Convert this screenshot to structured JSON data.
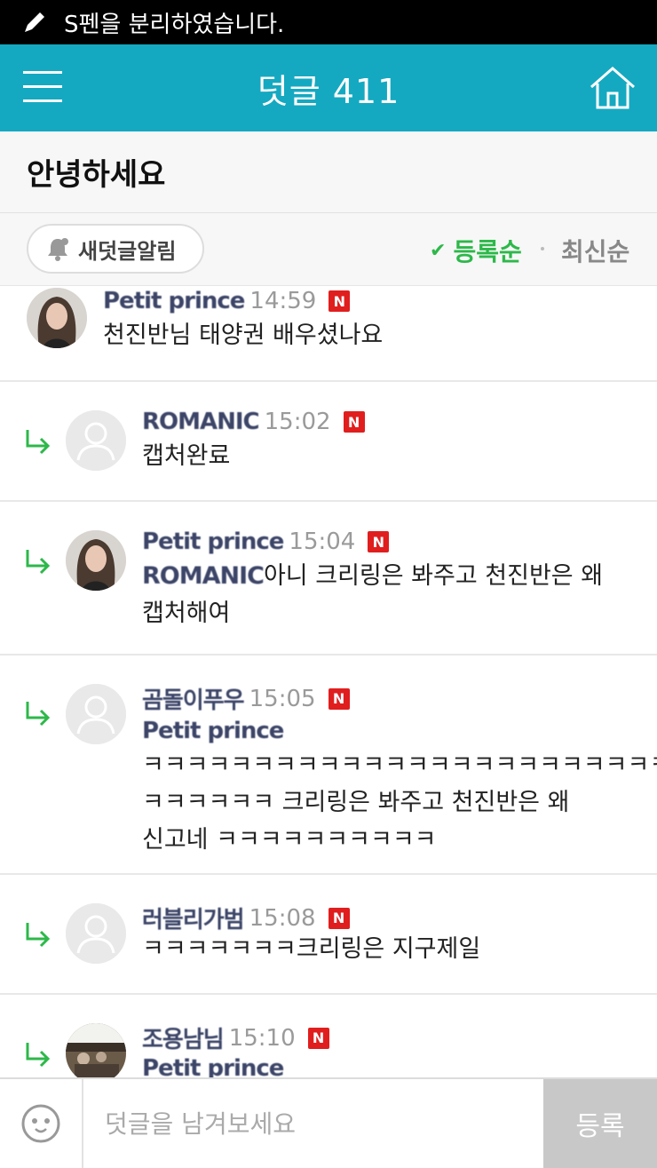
{
  "status_bar": {
    "text": "S펜을 분리하였습니다."
  },
  "header": {
    "title": "덧글 411"
  },
  "article": {
    "title": "안녕하세요"
  },
  "sort": {
    "notify_label": "새덧글알림",
    "by_registration": "등록순",
    "by_latest": "최신순",
    "active": "by_registration"
  },
  "comments": [
    {
      "nick": "Petit prince",
      "time": "14:59",
      "badge": "N",
      "text": "천진반님 태양권 배우셨나요",
      "reply": false
    },
    {
      "nick": "ROMANIC",
      "time": "15:02",
      "badge": "N",
      "text": "캡처완료",
      "reply": true
    },
    {
      "nick": "Petit prince",
      "time": "15:04",
      "badge": "N",
      "mention": "ROMANIC",
      "text_line1": "아니 크리링은 봐주고 천진반은 왜",
      "text_line2": "캡처해여",
      "reply": true
    },
    {
      "nick": "곰돌이푸우",
      "time": "15:05",
      "badge": "N",
      "mention": "Petit prince",
      "text_line1": "ㅋㅋㅋㅋㅋㅋㅋㅋㅋㅋㅋㅋㅋㅋㅋㅋㅋㅋㅋㅋㅋㅋㅋㅋㅋ",
      "text_line2": "ㅋㅋㅋㅋㅋㅋ 크리링은 봐주고 천진반은 왜",
      "text_line3": "신고네 ㅋㅋㅋㅋㅋㅋㅋㅋㅋㅋ",
      "reply": true
    },
    {
      "nick": "러블리가범",
      "time": "15:08",
      "badge": "N",
      "text": "ㅋㅋㅋㅋㅋㅋㅋ크리링은 지구제일",
      "reply": true
    },
    {
      "nick": "조용남님",
      "time": "15:10",
      "badge": "N",
      "mention": "Petit prince",
      "reply": true
    }
  ],
  "input": {
    "placeholder": "덧글을 남겨보세요",
    "submit_label": "등록"
  },
  "colors": {
    "header": "#14a9c1",
    "accent_green": "#2db84a",
    "badge_red": "#e01e1e"
  }
}
